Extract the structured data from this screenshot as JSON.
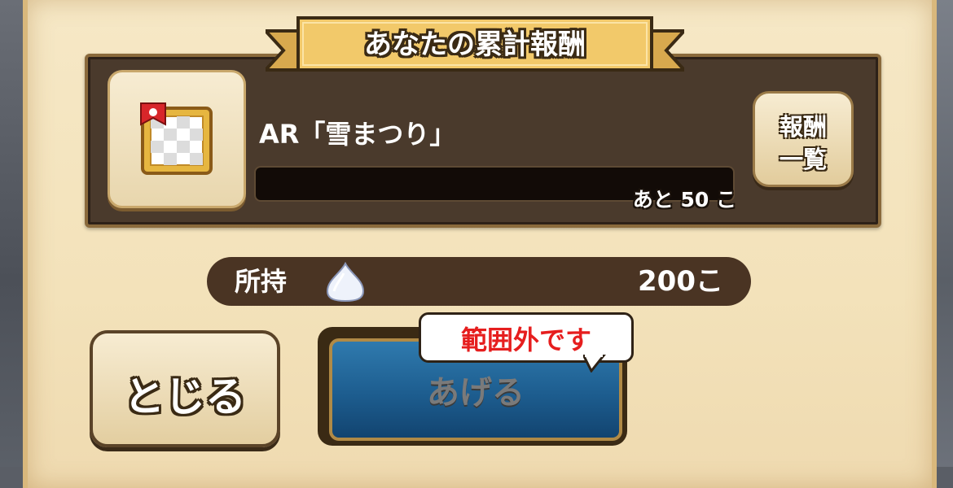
{
  "dialog": {
    "title": "あなたの累計報酬",
    "reward": {
      "item_name": "AR「雪まつり」",
      "progress_fraction": 0,
      "remaining_text": "あと 50 こ",
      "list_button_line1": "報酬",
      "list_button_line2": "一覧",
      "item_icon": "picture-frame-icon"
    },
    "holding": {
      "label": "所持",
      "icon": "white-drop-icon",
      "value": "200こ"
    },
    "buttons": {
      "close_label": "とじる",
      "give_label": "あげる"
    },
    "tooltip": "範囲外です"
  },
  "colors": {
    "parchment": "#f3e2ba",
    "panel": "#4a3a2c",
    "give_button": "#1d5d8f",
    "tooltip_text": "#e61e1e"
  }
}
